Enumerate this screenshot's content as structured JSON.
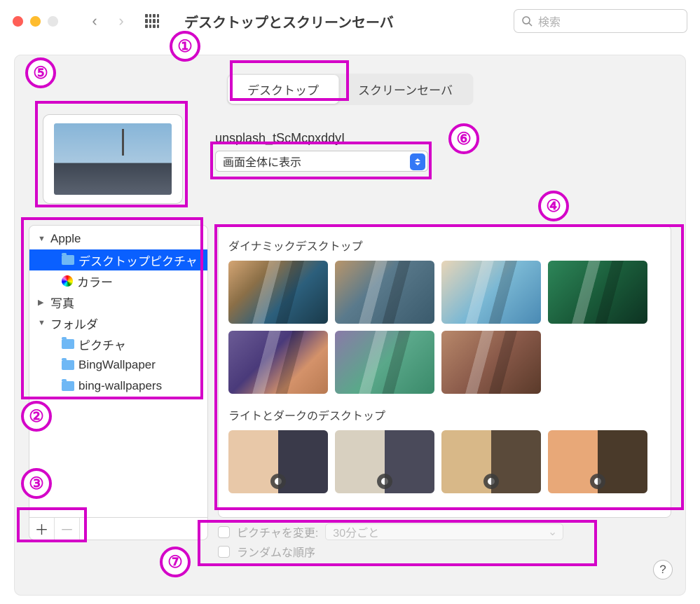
{
  "window": {
    "title": "デスクトップとスクリーンセーバ",
    "search_placeholder": "検索"
  },
  "tabs": {
    "desktop": "デスクトップ",
    "screensaver": "スクリーンセーバ"
  },
  "current": {
    "name": "unsplash_tScMcpxddyI",
    "fit_mode": "画面全体に表示"
  },
  "tree": {
    "apple": "Apple",
    "desktop_pictures": "デスクトップピクチャ",
    "colors": "カラー",
    "photos": "写真",
    "folders": "フォルダ",
    "items": [
      "ピクチャ",
      "BingWallpaper",
      "bing-wallpapers"
    ]
  },
  "sections": {
    "dynamic": "ダイナミックデスクトップ",
    "lightdark": "ライトとダークのデスクトップ"
  },
  "options": {
    "change_label": "ピクチャを変更:",
    "interval": "30分ごと",
    "random_label": "ランダムな順序"
  },
  "callouts": [
    "①",
    "②",
    "③",
    "④",
    "⑤",
    "⑥",
    "⑦"
  ],
  "colors": {
    "accent": "#0a60ff",
    "highlight": "#d400c8"
  }
}
